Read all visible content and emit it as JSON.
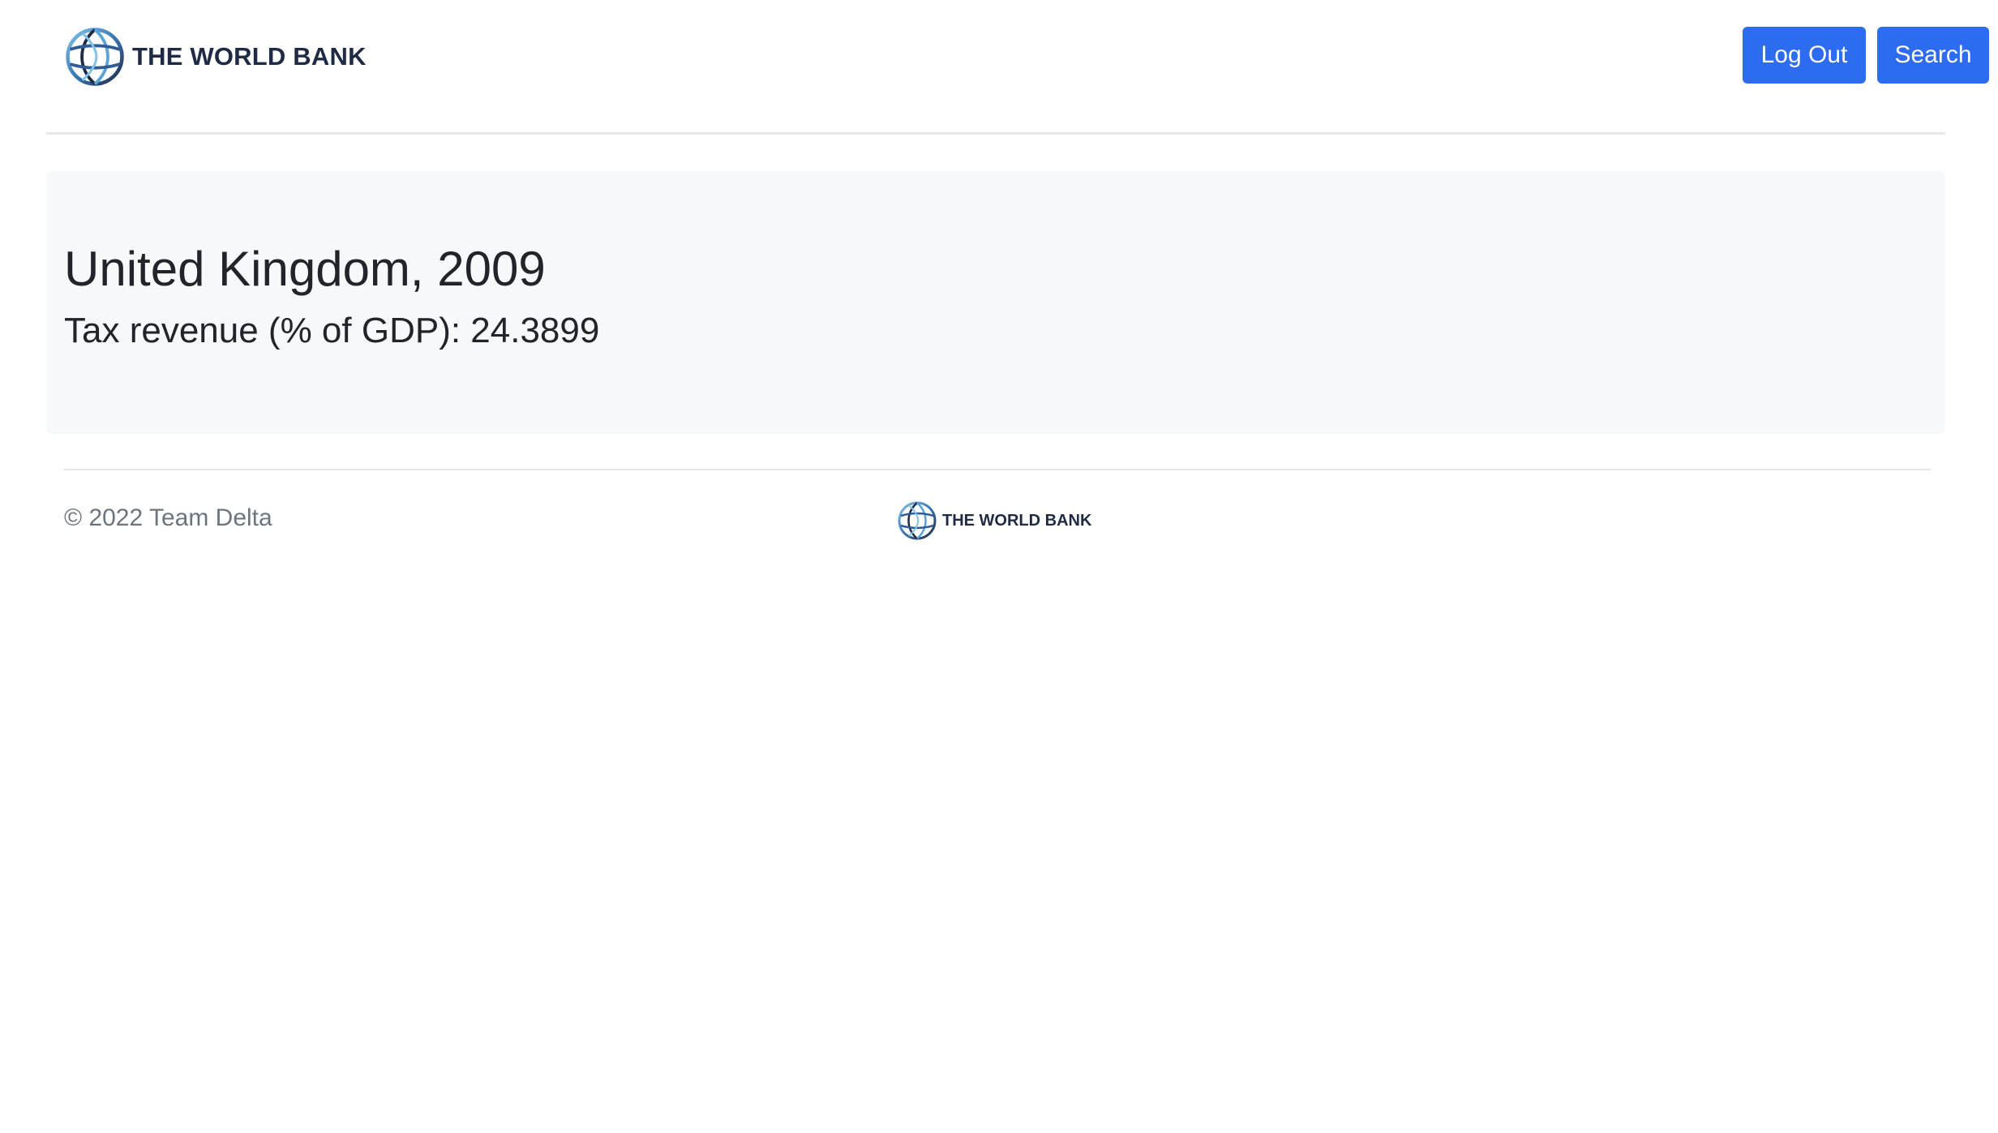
{
  "header": {
    "brand_name": "THE WORLD BANK",
    "logout_label": "Log Out",
    "search_label": "Search"
  },
  "main": {
    "title": "United Kingdom, 2009",
    "stat_text": "Tax revenue (% of GDP): 24.3899"
  },
  "footer": {
    "copyright": "© 2022 Team Delta",
    "brand_name": "THE WORLD BANK"
  },
  "colors": {
    "primary_button": "#2d6bf0",
    "brand_navy": "#1f2a44",
    "jumbotron_bg": "#f7f8fa",
    "muted_text": "#6c757d"
  },
  "icons": {
    "logo": "world-bank-globe-icon"
  }
}
